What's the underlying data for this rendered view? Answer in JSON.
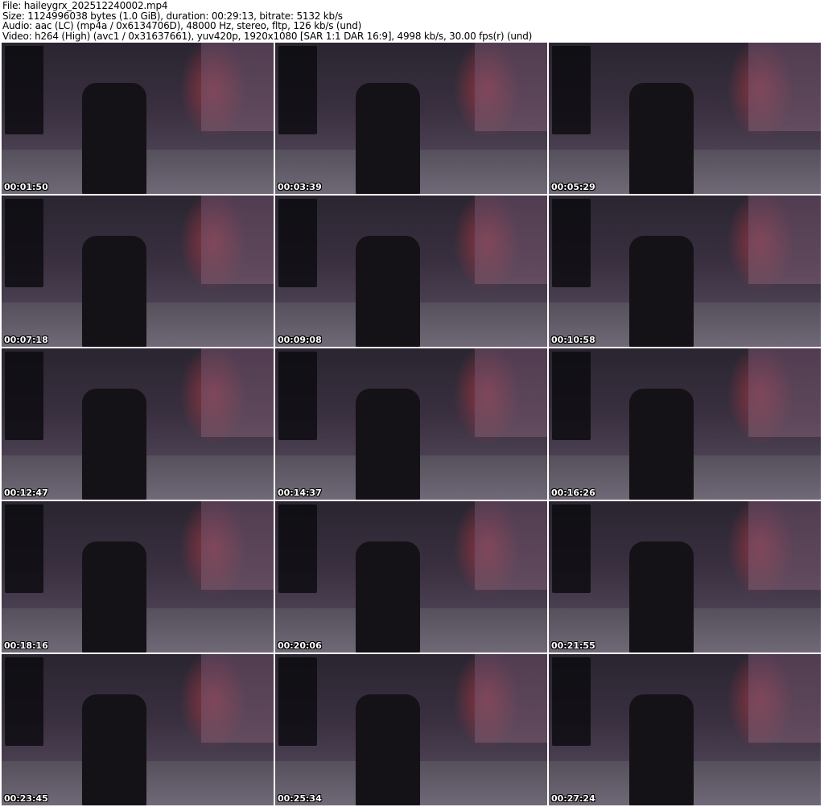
{
  "header": {
    "file": "File: haileygrx_202512240002.mp4",
    "size": "Size: 1124996038 bytes (1.0 GiB), duration: 00:29:13, bitrate: 5132 kb/s",
    "audio": "Audio: aac (LC) (mp4a / 0x6134706D), 48000 Hz, stereo, fltp, 126 kb/s (und)",
    "video": "Video: h264 (High) (avc1 / 0x31637661), yuv420p, 1920x1080 [SAR 1:1 DAR 16:9], 4998 kb/s, 30.00 fps(r) (und)"
  },
  "thumbnails": [
    {
      "time": "00:01:50"
    },
    {
      "time": "00:03:39"
    },
    {
      "time": "00:05:29"
    },
    {
      "time": "00:07:18"
    },
    {
      "time": "00:09:08"
    },
    {
      "time": "00:10:58"
    },
    {
      "time": "00:12:47"
    },
    {
      "time": "00:14:37"
    },
    {
      "time": "00:16:26"
    },
    {
      "time": "00:18:16"
    },
    {
      "time": "00:20:06"
    },
    {
      "time": "00:21:55"
    },
    {
      "time": "00:23:45"
    },
    {
      "time": "00:25:34"
    },
    {
      "time": "00:27:24"
    }
  ]
}
